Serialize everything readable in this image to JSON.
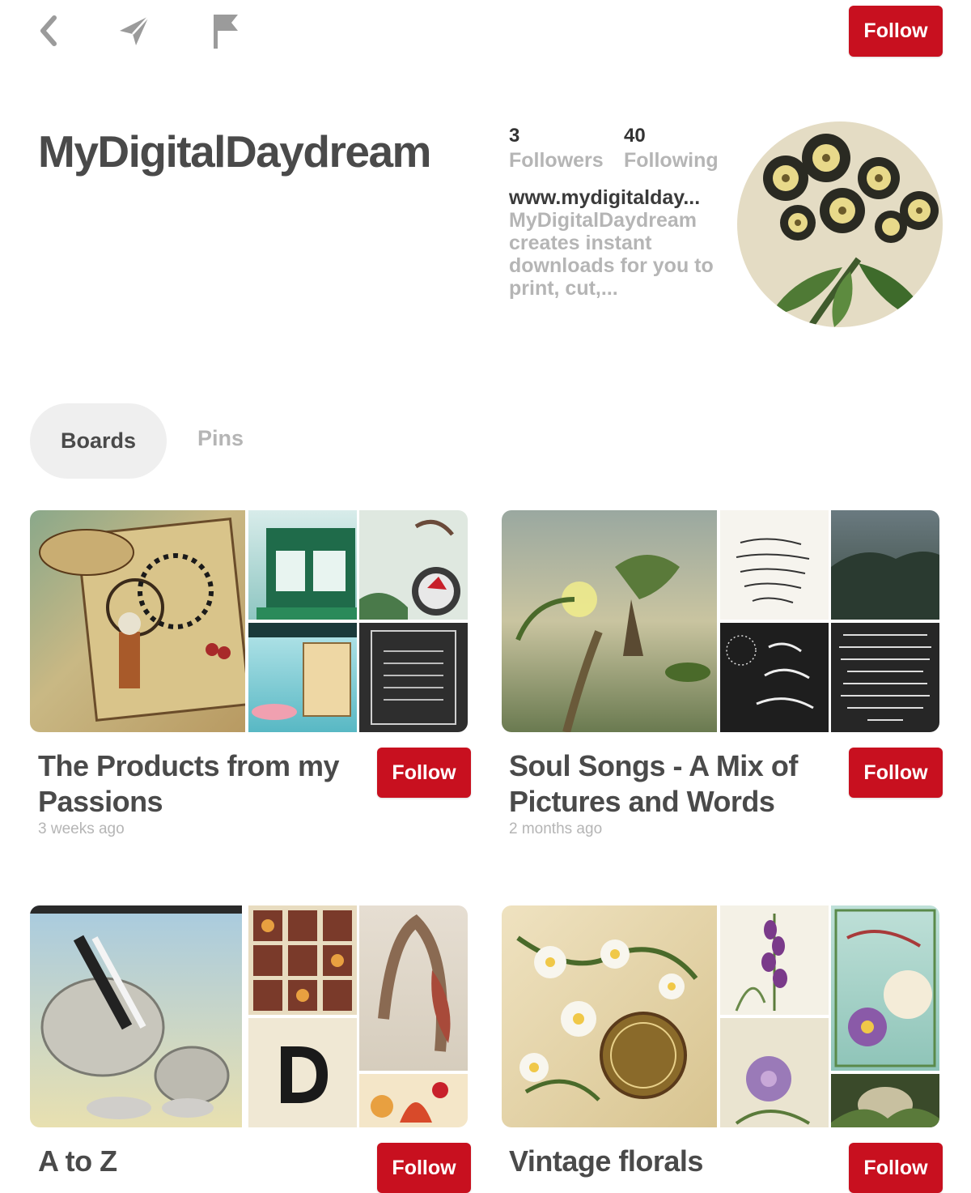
{
  "topbar": {
    "back_icon": "chevron-left-icon",
    "send_icon": "paper-plane-icon",
    "report_icon": "flag-icon",
    "follow_label": "Follow"
  },
  "profile": {
    "name": "MyDigitalDaydream",
    "followers_count": "3",
    "followers_label": "Followers",
    "following_count": "40",
    "following_label": "Following",
    "website": "www.mydigitalday...",
    "bio": "MyDigitalDaydream creates instant downloads for you to print, cut,..."
  },
  "tabs": [
    {
      "label": "Boards",
      "active": true
    },
    {
      "label": "Pins",
      "active": false
    }
  ],
  "boards": [
    {
      "title": "The Products from my Passions",
      "meta": "3 weeks ago",
      "follow_label": "Follow"
    },
    {
      "title": "Soul Songs - A Mix of Pictures and Words",
      "meta": "2 months ago",
      "follow_label": "Follow"
    },
    {
      "title": "A to Z",
      "meta": "",
      "follow_label": "Follow"
    },
    {
      "title": "Vintage florals",
      "meta": "",
      "follow_label": "Follow"
    }
  ],
  "colors": {
    "accent": "#c8101f",
    "text": "#4a4a4a",
    "muted": "#b5b5b5",
    "tab_bg": "#efefef"
  }
}
